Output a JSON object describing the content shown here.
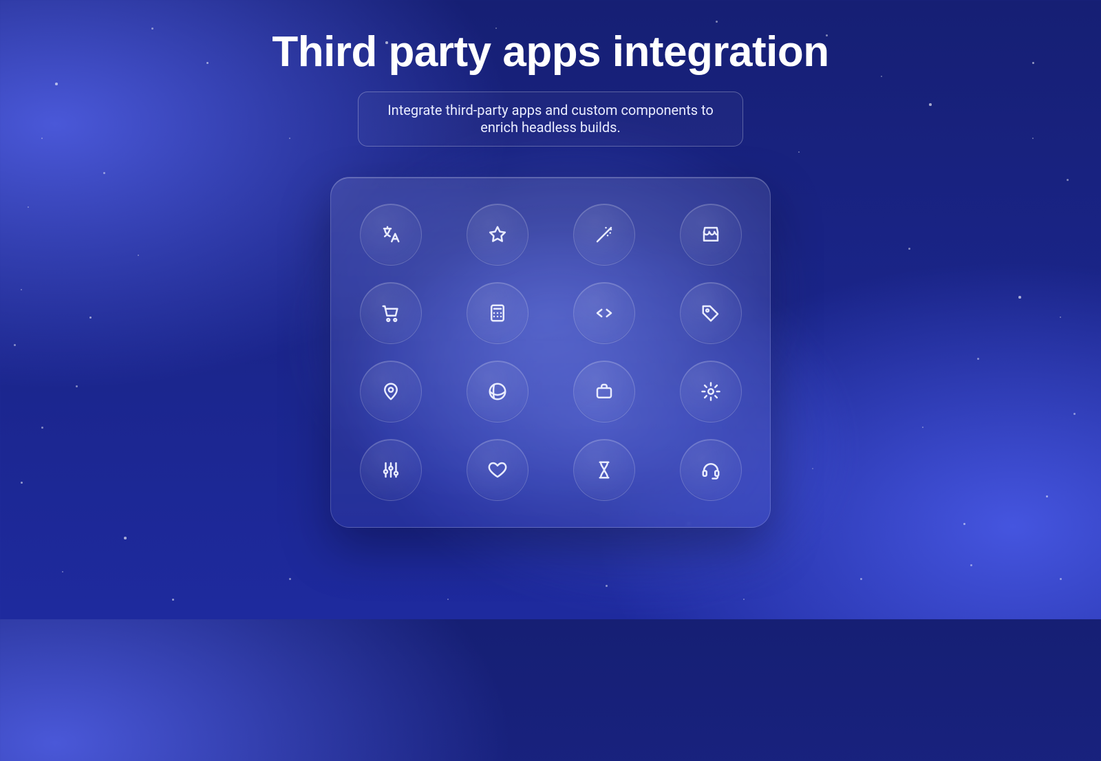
{
  "header": {
    "title": "Third party apps integration",
    "subtitle": "Integrate third-party apps and custom components to enrich headless builds."
  },
  "grid": {
    "items": [
      {
        "id": "translate",
        "icon": "translate-icon"
      },
      {
        "id": "star",
        "icon": "star-icon"
      },
      {
        "id": "magic-wand",
        "icon": "magic-wand-icon"
      },
      {
        "id": "storefront",
        "icon": "storefront-icon"
      },
      {
        "id": "cart",
        "icon": "cart-icon"
      },
      {
        "id": "calculator",
        "icon": "calculator-icon"
      },
      {
        "id": "code",
        "icon": "code-icon"
      },
      {
        "id": "tag",
        "icon": "tag-icon"
      },
      {
        "id": "map-pin",
        "icon": "map-pin-icon"
      },
      {
        "id": "globe",
        "icon": "globe-icon"
      },
      {
        "id": "briefcase",
        "icon": "briefcase-icon"
      },
      {
        "id": "settings",
        "icon": "settings-icon"
      },
      {
        "id": "sliders",
        "icon": "sliders-icon"
      },
      {
        "id": "heart",
        "icon": "heart-icon"
      },
      {
        "id": "hourglass",
        "icon": "hourglass-icon"
      },
      {
        "id": "headset",
        "icon": "headset-icon"
      }
    ]
  },
  "colors": {
    "background_deep": "#161f74",
    "background_light": "#4a58d8",
    "text": "#eef0ff"
  }
}
